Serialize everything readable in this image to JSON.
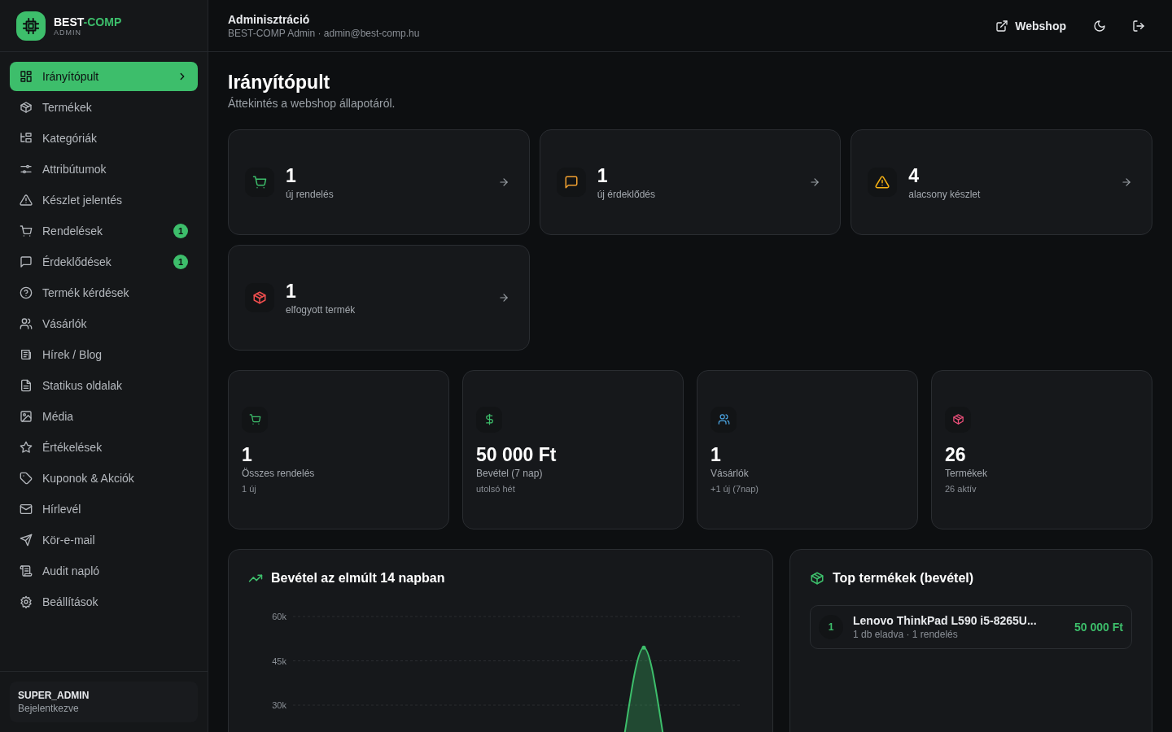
{
  "brand": {
    "name": "BEST",
    "accent": "-COMP",
    "subtitle": "ADMIN"
  },
  "nav": [
    {
      "label": "Irányítópult",
      "selected": true
    },
    {
      "label": "Termékek",
      "selected": false
    },
    {
      "label": "Kategóriák",
      "selected": false
    },
    {
      "label": "Attribútumok",
      "selected": false
    },
    {
      "label": "Készlet jelentés",
      "selected": false
    },
    {
      "label": "Rendelések",
      "selected": false,
      "badge": "1"
    },
    {
      "label": "Érdeklődések",
      "selected": false,
      "badge": "1"
    },
    {
      "label": "Termék kérdések",
      "selected": false
    },
    {
      "label": "Vásárlók",
      "selected": false
    },
    {
      "label": "Hírek / Blog",
      "selected": false
    },
    {
      "label": "Statikus oldalak",
      "selected": false
    },
    {
      "label": "Média",
      "selected": false
    },
    {
      "label": "Értékelések",
      "selected": false
    },
    {
      "label": "Kuponok & Akciók",
      "selected": false
    },
    {
      "label": "Hírlevél",
      "selected": false
    },
    {
      "label": "Kör-e-mail",
      "selected": false
    },
    {
      "label": "Audit napló",
      "selected": false
    },
    {
      "label": "Beállítások",
      "selected": false
    }
  ],
  "sidebar_footer": {
    "role": "SUPER_ADMIN",
    "status": "Bejelentkezve"
  },
  "header": {
    "title": "Adminisztráció",
    "subtitle": "BEST-COMP Admin · admin@best-comp.hu",
    "webshop_link": "Webshop"
  },
  "page": {
    "title": "Irányítópult",
    "subtitle": "Áttekintés a webshop állapotáról."
  },
  "alerts": [
    {
      "kind": "cart",
      "value": "1",
      "label": "új rendelés",
      "color": "#3dbe6b"
    },
    {
      "kind": "message",
      "value": "1",
      "label": "új érdeklődés",
      "color": "#f0a030"
    },
    {
      "kind": "warning",
      "value": "4",
      "label": "alacsony készlet",
      "color": "#f5b014"
    },
    {
      "kind": "package",
      "value": "1",
      "label": "elfogyott termék",
      "color": "#ef4e4e"
    }
  ],
  "stats": [
    {
      "kind": "cart",
      "value": "1",
      "label": "Összes rendelés",
      "note": "1 új",
      "color": "#3dbe6b"
    },
    {
      "kind": "dollar",
      "value": "50 000 Ft",
      "label": "Bevétel (7 nap)",
      "note": "utolsó hét",
      "color": "#3dbe6b"
    },
    {
      "kind": "users",
      "value": "1",
      "label": "Vásárlók",
      "note": "+1 új (7nap)",
      "color": "#4aa3e0"
    },
    {
      "kind": "package",
      "value": "26",
      "label": "Termékek",
      "note": "26 aktív",
      "color": "#ec4f7a"
    }
  ],
  "revenue": {
    "title": "Bevétel az elmúlt 14 napban",
    "y_axis_labels": [
      "60k",
      "45k",
      "30k"
    ]
  },
  "top_products": {
    "title": "Top termékek (bevétel)",
    "items": [
      {
        "rank": "1",
        "name": "Lenovo ThinkPad L590 i5-8265U...",
        "meta": "1 db eladva · 1 rendelés",
        "amount": "50 000 Ft"
      }
    ]
  }
}
